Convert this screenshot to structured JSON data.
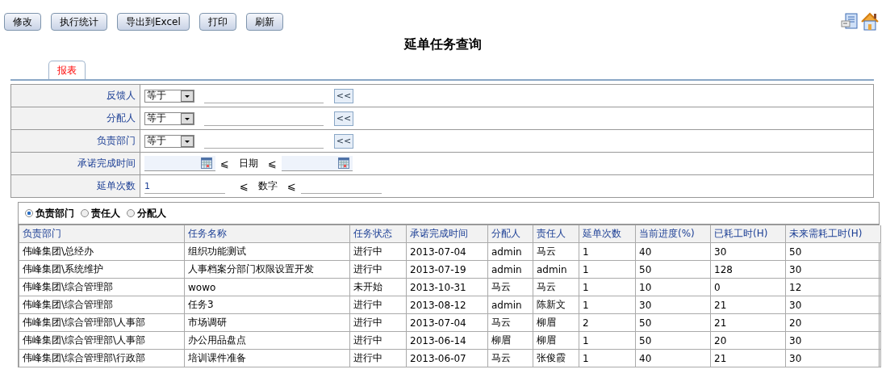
{
  "toolbar": {
    "buttons": [
      "修改",
      "执行统计",
      "导出到Excel",
      "打印",
      "刷新"
    ]
  },
  "title": "延单任务查询",
  "tabs": [
    {
      "label": "报表",
      "selected": true
    }
  ],
  "filters": [
    {
      "kind": "select",
      "label": "反馈人",
      "operator": "等于",
      "button": "<<"
    },
    {
      "kind": "select",
      "label": "分配人",
      "operator": "等于",
      "button": "<<"
    },
    {
      "kind": "select",
      "label": "负责部门",
      "operator": "等于",
      "button": "<<"
    },
    {
      "kind": "date",
      "label": "承诺完成时间",
      "op_left": "⩽",
      "middle": "日期",
      "op_right": "⩽"
    },
    {
      "kind": "number",
      "label": "延单次数",
      "value": "1",
      "op_left": "⩽",
      "middle": "数字",
      "op_right": "⩽"
    }
  ],
  "group_by": [
    {
      "label": "负责部门",
      "selected": true
    },
    {
      "label": "责任人",
      "selected": false
    },
    {
      "label": "分配人",
      "selected": false
    }
  ],
  "table": {
    "columns": [
      "负责部门",
      "任务名称",
      "任务状态",
      "承诺完成时间",
      "分配人",
      "责任人",
      "延单次数",
      "当前进度(%)",
      "已耗工时(H)",
      "未来需耗工时(H)"
    ],
    "rows": [
      [
        "伟峰集团\\总经办",
        "组织功能测试",
        "进行中",
        "2013-07-04",
        "admin",
        "马云",
        "1",
        "40",
        "30",
        "50"
      ],
      [
        "伟峰集团\\系统维护",
        "人事档案分部门权限设置开发",
        "进行中",
        "2013-07-19",
        "admin",
        "admin",
        "1",
        "50",
        "128",
        "30"
      ],
      [
        "伟峰集团\\综合管理部",
        "wowo",
        "未开始",
        "2013-10-31",
        "马云",
        "马云",
        "1",
        "10",
        "0",
        "12"
      ],
      [
        "伟峰集团\\综合管理部",
        "任务3",
        "进行中",
        "2013-08-12",
        "admin",
        "陈新文",
        "1",
        "30",
        "21",
        "30"
      ],
      [
        "伟峰集团\\综合管理部\\人事部",
        "市场调研",
        "进行中",
        "2013-07-04",
        "马云",
        "柳眉",
        "2",
        "50",
        "21",
        "20"
      ],
      [
        "伟峰集团\\综合管理部\\人事部",
        "办公用品盘点",
        "进行中",
        "2013-06-14",
        "柳眉",
        "柳眉",
        "1",
        "50",
        "20",
        "30"
      ],
      [
        "伟峰集团\\综合管理部\\行政部",
        "培训课件准备",
        "进行中",
        "2013-06-07",
        "马云",
        "张俊霞",
        "1",
        "40",
        "21",
        "30"
      ]
    ]
  }
}
